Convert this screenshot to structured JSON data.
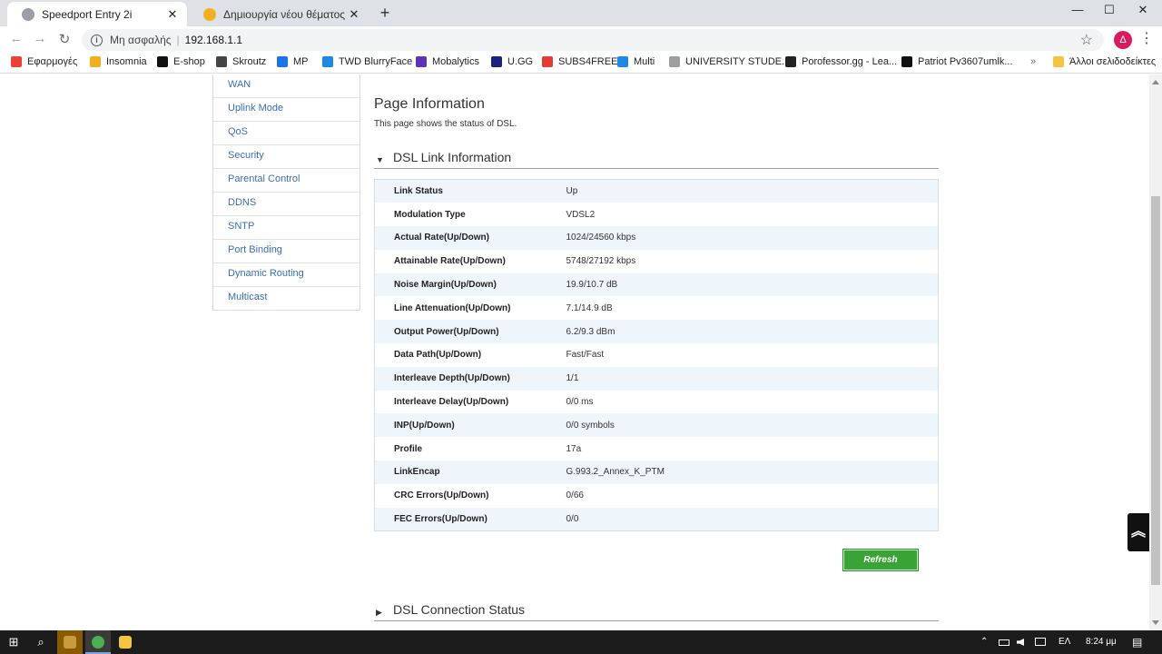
{
  "browser": {
    "tabs": [
      {
        "title": "Speedport Entry 2i",
        "close": "✕",
        "active": true
      },
      {
        "title": "Δημιουργία νέου θέματος - Insomnia",
        "close": "✕",
        "active": false
      }
    ],
    "new_tab": "+",
    "window_controls": {
      "minimize": "—",
      "maximize": "☐",
      "close": "✕"
    },
    "nav": {
      "back": "←",
      "forward": "→",
      "reload": "↻"
    },
    "address": {
      "security_label": "Μη ασφαλής",
      "separator": "|",
      "url": "192.168.1.1",
      "info_icon": "i",
      "star": "☆"
    },
    "profile_initial": "Δ",
    "menu": "⋮",
    "bookmarks": [
      {
        "label": "Εφαρμογές",
        "color": "#e94235"
      },
      {
        "label": "Insomnia",
        "color": "#f2b01e"
      },
      {
        "label": "E-shop",
        "color": "#111111"
      },
      {
        "label": "Skroutz",
        "color": "#444444"
      },
      {
        "label": "MP",
        "color": "#1a73e8"
      },
      {
        "label": "TWD BlurryFace",
        "color": "#1e88e5"
      },
      {
        "label": "Mobalytics",
        "color": "#5e35b1"
      },
      {
        "label": "U.GG",
        "color": "#1a237e"
      },
      {
        "label": "SUBS4FREE",
        "color": "#e53935"
      },
      {
        "label": "Multi",
        "color": "#1e88e5"
      },
      {
        "label": "UNIVERSITY STUDE...",
        "color": "#9e9e9e"
      },
      {
        "label": "Porofessor.gg - Lea...",
        "color": "#222222"
      },
      {
        "label": "Patriot Pv3607umlk...",
        "color": "#111111"
      }
    ],
    "bookmarks_more": "»",
    "other_bookmarks": "Άλλοι σελιδοδείκτες"
  },
  "sidebar": {
    "items": [
      "WAN",
      "Uplink Mode",
      "QoS",
      "Security",
      "Parental Control",
      "DDNS",
      "SNTP",
      "Port Binding",
      "Dynamic Routing",
      "Multicast"
    ]
  },
  "page": {
    "title": "Page Information",
    "description": "This page shows the status of DSL.",
    "section_expanded": {
      "arrow": "▼",
      "title": "DSL Link Information"
    },
    "section_collapsed": {
      "arrow": "▶",
      "title": "DSL Connection Status"
    },
    "rows": [
      {
        "label": "Link Status",
        "value": "Up"
      },
      {
        "label": "Modulation Type",
        "value": "VDSL2"
      },
      {
        "label": "Actual Rate(Up/Down)",
        "value": "1024/24560 kbps"
      },
      {
        "label": "Attainable Rate(Up/Down)",
        "value": "5748/27192 kbps"
      },
      {
        "label": "Noise Margin(Up/Down)",
        "value": "19.9/10.7 dB"
      },
      {
        "label": "Line Attenuation(Up/Down)",
        "value": "7.1/14.9 dB"
      },
      {
        "label": "Output Power(Up/Down)",
        "value": "6.2/9.3 dBm"
      },
      {
        "label": "Data Path(Up/Down)",
        "value": "Fast/Fast"
      },
      {
        "label": "Interleave Depth(Up/Down)",
        "value": "1/1"
      },
      {
        "label": "Interleave Delay(Up/Down)",
        "value": "0/0 ms"
      },
      {
        "label": "INP(Up/Down)",
        "value": "0/0 symbols"
      },
      {
        "label": "Profile",
        "value": "17a"
      },
      {
        "label": "LinkEncap",
        "value": "G.993.2_Annex_K_PTM"
      },
      {
        "label": "CRC Errors(Up/Down)",
        "value": "0/66"
      },
      {
        "label": "FEC Errors(Up/Down)",
        "value": "0/0"
      }
    ],
    "refresh_label": "Refresh",
    "back_to_top": "︽"
  },
  "taskbar": {
    "start": "⊞",
    "search": "⌕",
    "tray": {
      "chevron": "⌃",
      "language": "ΕΛ",
      "time": "8:24 μμ",
      "notifications": "▤"
    }
  },
  "colors": {
    "link": "#3a6eb5",
    "row_alt": "#eef5fb",
    "refresh_green": "#3aa335",
    "profile": "#d81b60"
  }
}
